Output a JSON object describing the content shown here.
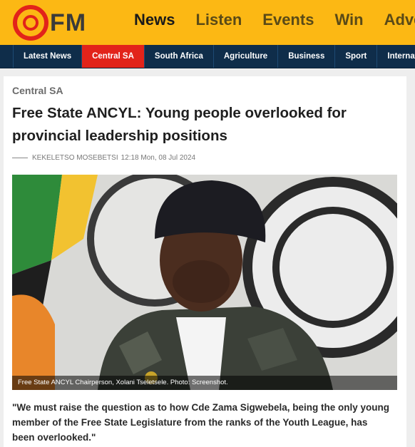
{
  "logo": {
    "text": "FM"
  },
  "main_nav": [
    "News",
    "Listen",
    "Events",
    "Win",
    "Adve"
  ],
  "sub_nav": [
    "Latest News",
    "Central SA",
    "South Africa",
    "Agriculture",
    "Business",
    "Sport",
    "Internat"
  ],
  "article": {
    "category": "Central SA",
    "headline": "Free State ANCYL: Young people overlooked for provincial leadership positions",
    "author": "KEKELETSO MOSEBETSI",
    "timestamp": "12:18 Mon, 08 Jul 2024",
    "photo_caption": "Free State ANCYL Chairperson, Xolani Tseletsele. Photo: Screenshot.",
    "lead_quote": "\"We must raise the question as to how Cde Zama Sigwebela, being the only young member of the Free State Legislature from the ranks of the Youth League, has been overlooked.\""
  },
  "colors": {
    "header_bg": "#fcb814",
    "subnav_bg": "#0f2d4a",
    "accent_red": "#e2231a"
  }
}
